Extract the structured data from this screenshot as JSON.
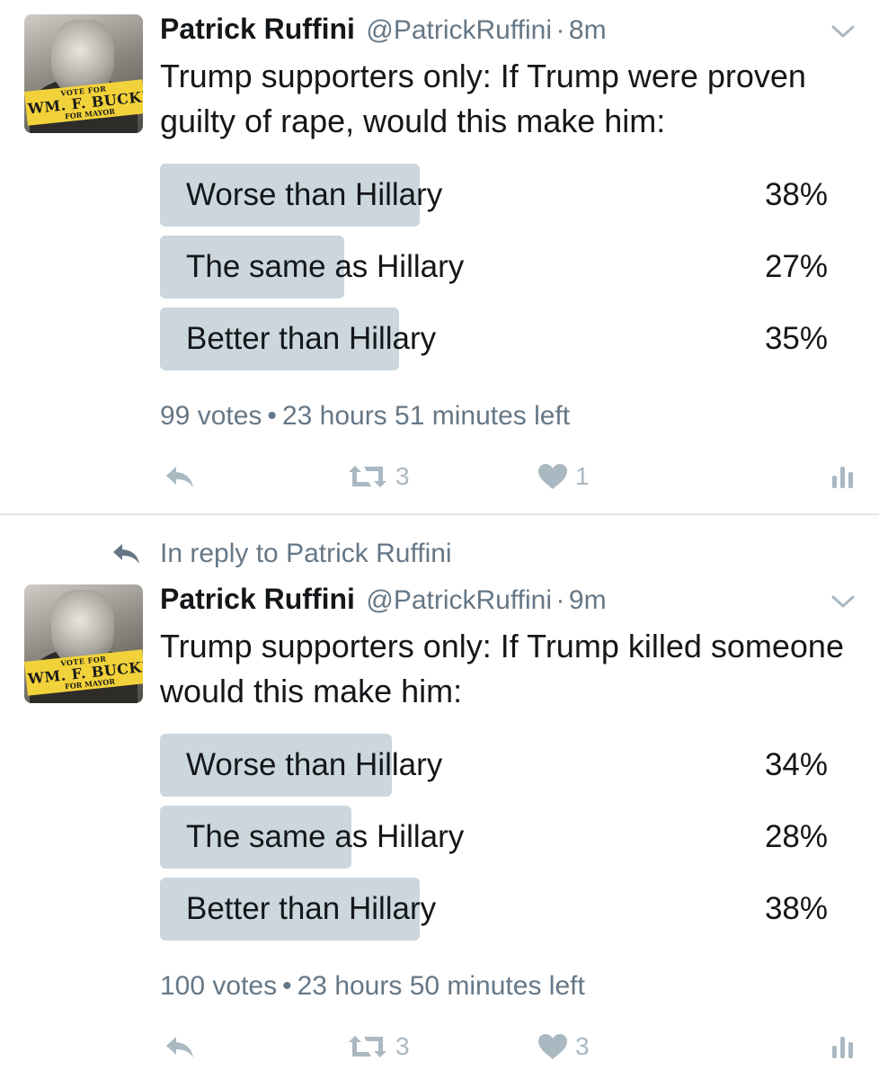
{
  "tweets": [
    {
      "author": {
        "name": "Patrick Ruffini",
        "handle": "@PatrickRuffini",
        "avatar_text": {
          "line1": "VOTE FOR",
          "line2": "WM. F. BUCKLEY JR.",
          "line3": "FOR MAYOR"
        }
      },
      "separator": "·",
      "time": "8m",
      "text": "Trump supporters only: If Trump were proven guilty of rape, would this make him:",
      "poll": {
        "options": [
          {
            "label": "Worse than Hillary",
            "percent": "38%",
            "value": 38
          },
          {
            "label": "The same as Hillary",
            "percent": "27%",
            "value": 27
          },
          {
            "label": "Better than Hillary",
            "percent": "35%",
            "value": 35
          }
        ],
        "votes": "99 votes",
        "bullet": "•",
        "time_left": "23 hours 51 minutes left"
      },
      "actions": {
        "retweets": "3",
        "likes": "1"
      }
    },
    {
      "reply_context": "In reply to Patrick Ruffini",
      "author": {
        "name": "Patrick Ruffini",
        "handle": "@PatrickRuffini",
        "avatar_text": {
          "line1": "VOTE FOR",
          "line2": "WM. F. BUCKLEY JR.",
          "line3": "FOR MAYOR"
        }
      },
      "separator": "·",
      "time": "9m",
      "text": "Trump supporters only: If Trump killed someone would this make him:",
      "poll": {
        "options": [
          {
            "label": "Worse than Hillary",
            "percent": "34%",
            "value": 34
          },
          {
            "label": "The same as Hillary",
            "percent": "28%",
            "value": 28
          },
          {
            "label": "Better than Hillary",
            "percent": "38%",
            "value": 38
          }
        ],
        "votes": "100 votes",
        "bullet": "•",
        "time_left": "23 hours 50 minutes left"
      },
      "actions": {
        "retweets": "3",
        "likes": "3"
      }
    }
  ],
  "colors": {
    "poll_bar": "#ccd6dd",
    "secondary_text": "#657786",
    "action_icon": "#aab8c2",
    "divider": "#e1e8ed"
  },
  "icons": [
    "chevron-down-icon",
    "reply-icon",
    "retweet-icon",
    "heart-icon",
    "analytics-icon",
    "reply-arrow-icon"
  ]
}
